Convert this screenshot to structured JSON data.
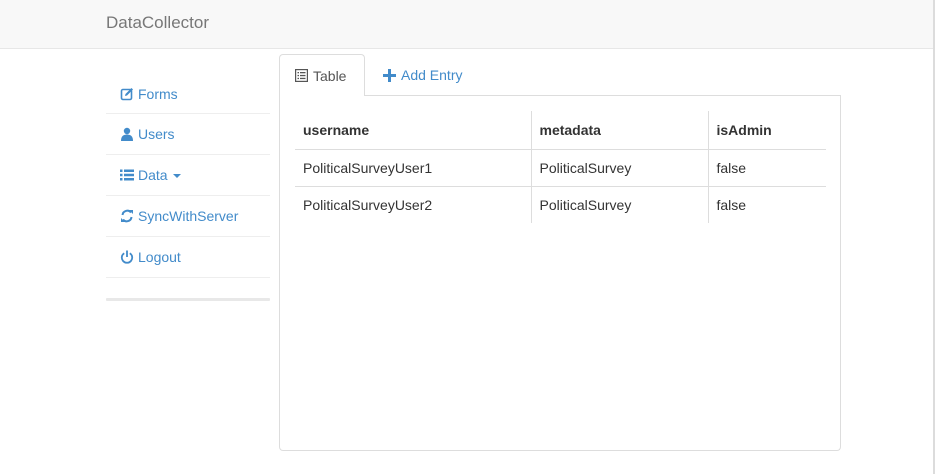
{
  "navbar": {
    "brand": "DataCollector"
  },
  "sidebar": {
    "items": [
      {
        "label": "Forms",
        "icon": "edit-icon"
      },
      {
        "label": "Users",
        "icon": "user-icon"
      },
      {
        "label": "Data",
        "icon": "list-icon",
        "dropdown": true
      },
      {
        "label": "SyncWithServer",
        "icon": "refresh-icon"
      },
      {
        "label": "Logout",
        "icon": "power-icon"
      }
    ]
  },
  "tabs": [
    {
      "label": "Table",
      "icon": "list-alt-icon",
      "active": true
    },
    {
      "label": "Add Entry",
      "icon": "plus-icon",
      "active": false
    }
  ],
  "table": {
    "columns": [
      "username",
      "metadata",
      "isAdmin"
    ],
    "rows": [
      [
        "PoliticalSurveyUser1",
        "PoliticalSurvey",
        "false"
      ],
      [
        "PoliticalSurveyUser2",
        "PoliticalSurvey",
        "false"
      ]
    ]
  },
  "colors": {
    "link": "#428bca",
    "navbar_bg": "#f8f8f8",
    "border": "#dddddd"
  }
}
